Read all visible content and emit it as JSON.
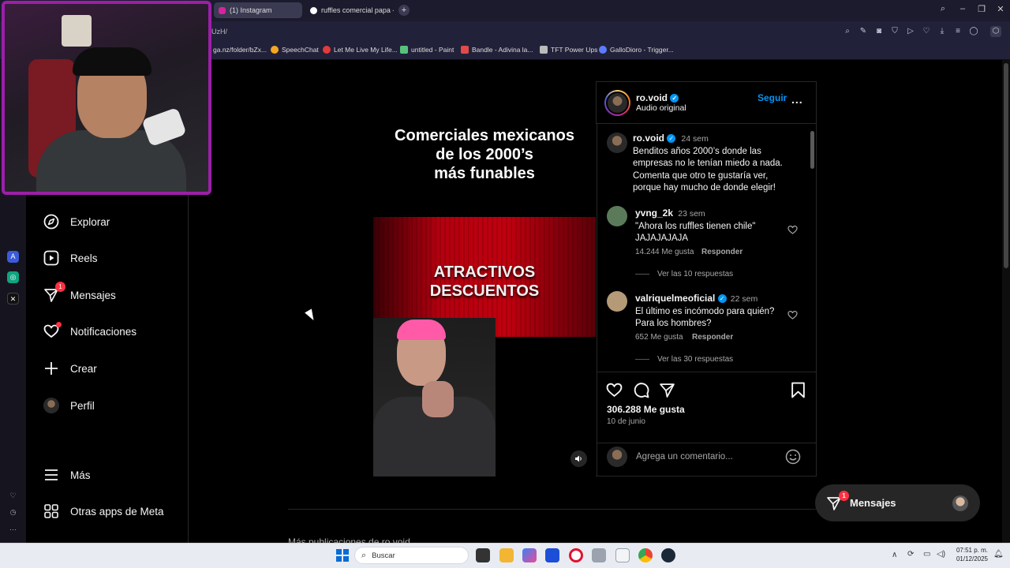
{
  "browser": {
    "tabs": [
      {
        "label": "(1) Instagram",
        "active": true
      },
      {
        "label": "ruffles comercial papa - G",
        "active": false
      }
    ],
    "new_tab": "+",
    "url": "UzH/",
    "bookmarks": [
      {
        "label": "ga.nz/folder/bZx...",
        "color": "#cccccc"
      },
      {
        "label": "SpeechChat",
        "color": "#f5a623"
      },
      {
        "label": "Let Me Live My Life...",
        "color": "#e23a3a"
      },
      {
        "label": "untitled - Paint",
        "color": "#58c27d"
      },
      {
        "label": "Bandle - Adivina la...",
        "color": "#e24a4a"
      },
      {
        "label": "TFT Power Ups",
        "color": "#bbbbbb"
      },
      {
        "label": "GalloDioro - Trigger...",
        "color": "#5b7cff"
      }
    ]
  },
  "nav": {
    "items": [
      {
        "label": "Explorar",
        "icon": "compass-icon"
      },
      {
        "label": "Reels",
        "icon": "reels-icon"
      },
      {
        "label": "Mensajes",
        "icon": "messenger-icon",
        "badge": "1"
      },
      {
        "label": "Notificaciones",
        "icon": "heart-icon"
      },
      {
        "label": "Crear",
        "icon": "plus-icon"
      },
      {
        "label": "Perfil",
        "icon": "avatar"
      },
      {
        "label": "Más",
        "icon": "menu-icon"
      },
      {
        "label": "Otras apps de Meta",
        "icon": "apps-icon"
      }
    ]
  },
  "post": {
    "video": {
      "headline_lines": [
        "Comerciales mexicanos",
        "de los 2000’s",
        "más funables"
      ],
      "promo_lines": [
        "ATRACTIVOS",
        "DESCUENTOS"
      ]
    },
    "author": {
      "username": "ro.void",
      "subtitle": "Audio original",
      "follow_label": "Seguir",
      "more": "..."
    },
    "caption": {
      "username": "ro.void",
      "time": "24 sem",
      "text": "Benditos años 2000’s donde las empresas no le tenían miedo a nada. Comenta que otro te gustaría ver, porque hay mucho de donde elegir!"
    },
    "comments": [
      {
        "username": "yvng_2k",
        "verified": false,
        "time": "23 sem",
        "text": "\"Ahora los ruffles tienen chile\" JAJAJAJAJA",
        "likes": "14.244 Me gusta",
        "reply": "Responder",
        "view_replies": "Ver las 10 respuestas"
      },
      {
        "username": "valriquelmeoficial",
        "verified": true,
        "time": "22 sem",
        "text": "El último es incómodo para quién? Para los hombres?",
        "likes": "652 Me gusta",
        "reply": "Responder",
        "view_replies": "Ver las 30 respuestas"
      }
    ],
    "likes": "306.288 Me gusta",
    "date": "10 de junio",
    "add_comment_placeholder": "Agrega un comentario..."
  },
  "more_posts": "Más publicaciones de ro.void",
  "messages_pill": {
    "label": "Mensajes",
    "badge": "1"
  },
  "taskbar": {
    "search_placeholder": "Buscar",
    "time": "07:51 p. m.",
    "date": "01/12/2025"
  },
  "colors": {
    "accent": "#0095f6",
    "badge": "#ff3040",
    "webcam_border": "#9c1fa8"
  }
}
